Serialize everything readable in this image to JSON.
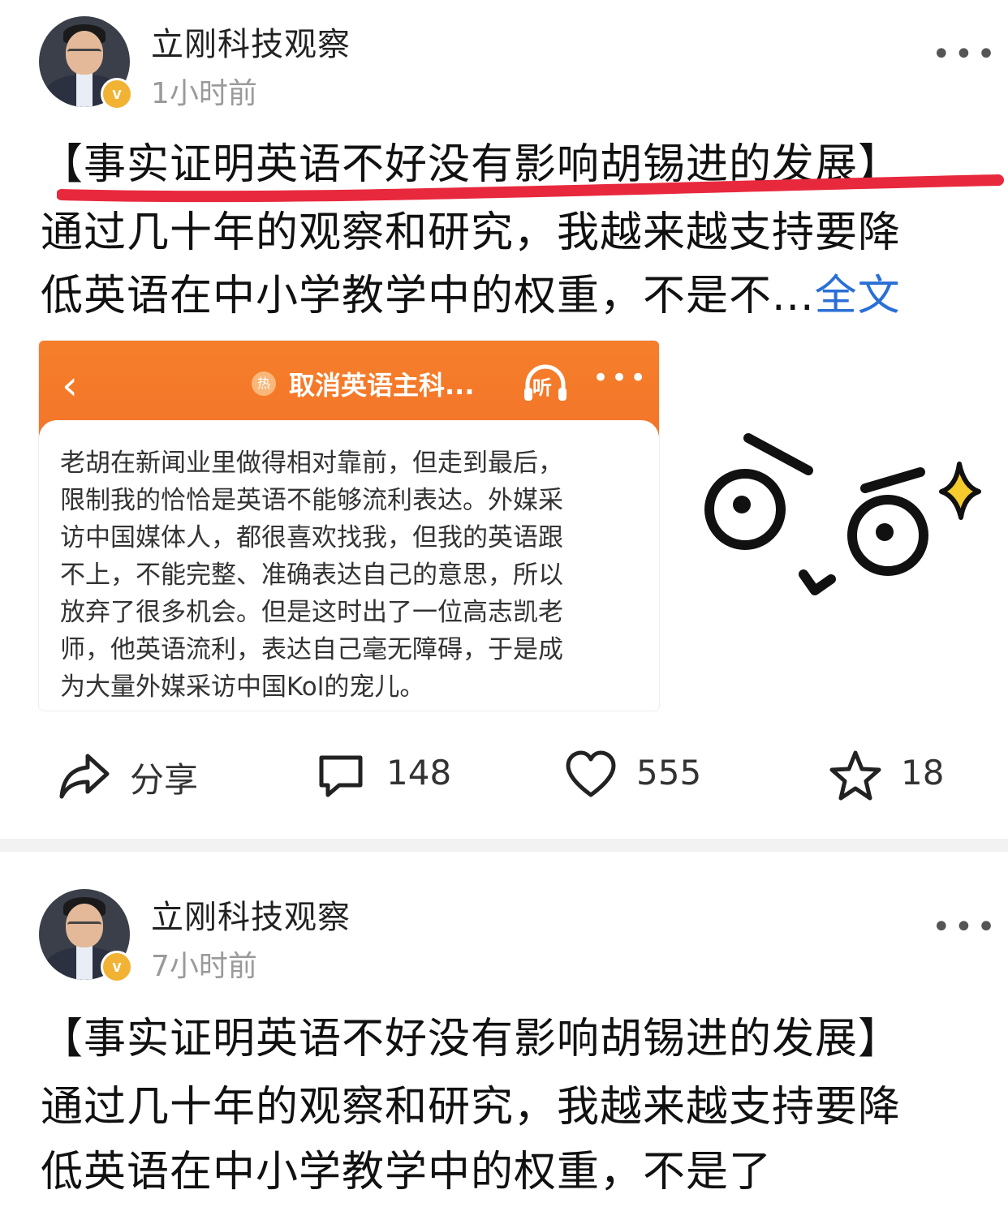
{
  "posts": [
    {
      "author": "立刚科技观察",
      "time": "1小时前",
      "title": "【事实证明英语不好没有影响胡锡进的发展】",
      "body_line1": "通过几十年的观察和研究，我越来越支持要降",
      "body_line2": "低英语在中小学教学中的权重，不是不...",
      "full_text_link": "全文",
      "embedded_screenshot": {
        "back": "‹",
        "title": "取消英语主科...",
        "listen": "听",
        "more": "•••",
        "lines": [
          "老胡在新闻业里做得相对靠前，但走到最后，",
          "限制我的恰恰是英语不能够流利表达。外媒采",
          "访中国媒体人，都很喜欢找我，但我的英语跟",
          "不上，不能完整、准确表达自己的意思，所以",
          "放弃了很多机会。但是这时出了一位高志凯老",
          "师，他英语流利，表达自己毫无障碍，于是成",
          "为大量外媒采访中国Kol的宠儿。"
        ]
      },
      "actions": {
        "share_label": "分享",
        "comments": "148",
        "likes": "555",
        "favorites": "18"
      }
    },
    {
      "author": "立刚科技观察",
      "time": "7小时前",
      "title": "【事实证明英语不好没有影响胡锡进的发展】",
      "body_line1": "通过几十年的观察和研究，我越来越支持要降",
      "body_line2": "低英语在中小学教学中的权重，不是了"
    }
  ],
  "icons": {
    "verified": "verified-badge-icon",
    "more": "more-dots-icon",
    "share": "share-arrow-icon",
    "comment": "comment-bubble-icon",
    "like": "heart-icon",
    "favorite": "star-icon"
  },
  "colors": {
    "link": "#2a6fd6",
    "app_bar": "#f57f2a",
    "highlight_stroke": "#e8293d",
    "verified": "#f2b233"
  }
}
